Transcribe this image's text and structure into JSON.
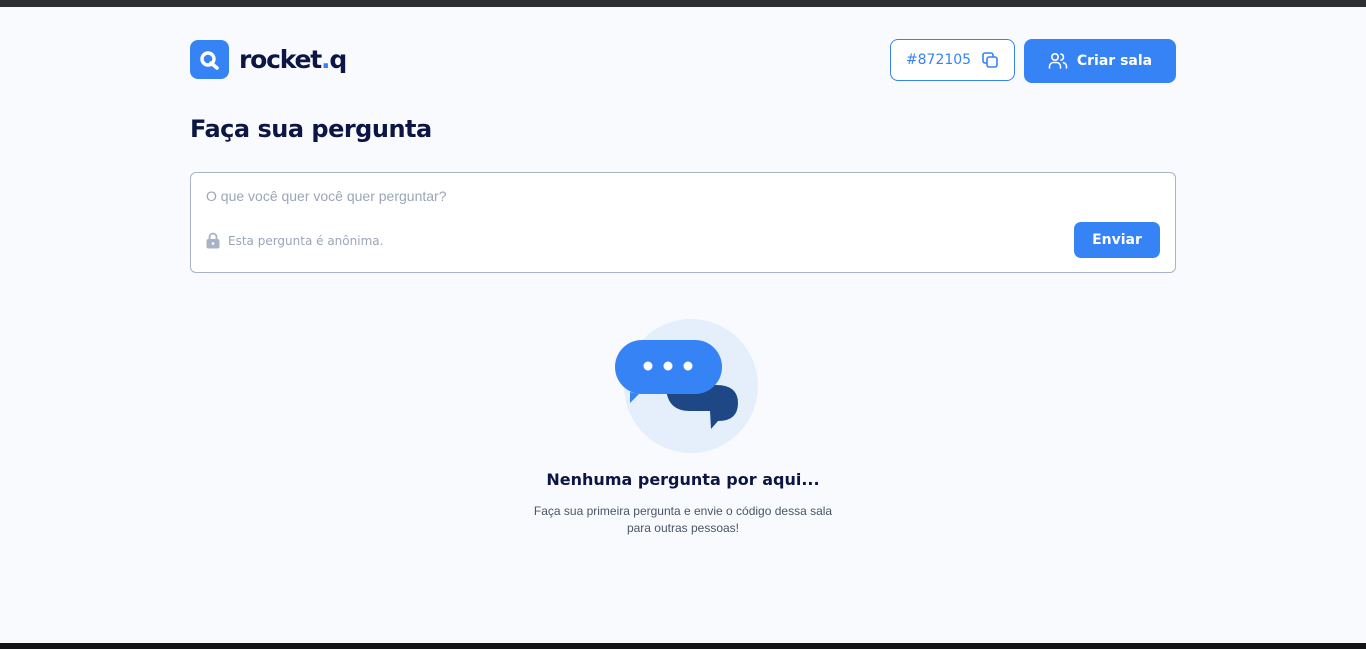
{
  "header": {
    "logo_text": "rocket",
    "logo_dot": ".",
    "logo_suffix": "q",
    "room_code": "#872105",
    "create_room_label": "Criar sala"
  },
  "main": {
    "title": "Faça sua pergunta",
    "question_placeholder": "O que você quer você quer perguntar?",
    "question_value": "",
    "anonymous_note": "Esta pergunta é anônima.",
    "send_label": "Enviar"
  },
  "empty_state": {
    "title": "Nenhuma pergunta por aqui...",
    "text": "Faça sua primeira pergunta e envie o código dessa sala para outras pessoas!"
  },
  "icons": {
    "logo": "search-bubble-icon",
    "copy": "copy-icon",
    "users": "users-icon",
    "lock": "lock-icon",
    "chat": "chat-bubbles-icon"
  },
  "colors": {
    "primary": "#3683f5",
    "dark_blue": "#1e4785",
    "title": "#0c1544",
    "background": "#f8fafd"
  }
}
